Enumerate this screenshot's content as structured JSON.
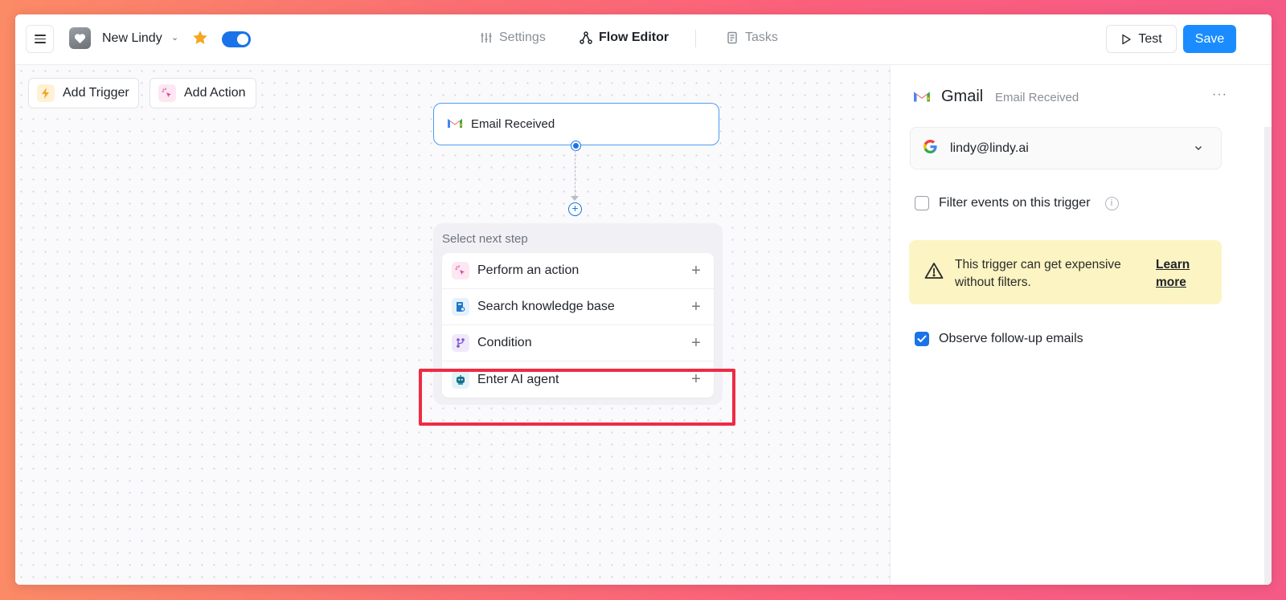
{
  "header": {
    "app_title": "New Lindy",
    "nav": {
      "settings": "Settings",
      "flow_editor": "Flow Editor",
      "tasks": "Tasks"
    },
    "test_label": "Test",
    "save_label": "Save",
    "toggle_on": true
  },
  "canvas": {
    "add_trigger": "Add Trigger",
    "add_action": "Add Action",
    "trigger_node": "Email Received",
    "next_step": {
      "title": "Select next step",
      "items": [
        {
          "label": "Perform an action",
          "icon": "sparkle-cursor-icon"
        },
        {
          "label": "Search knowledge base",
          "icon": "knowledge-base-icon"
        },
        {
          "label": "Condition",
          "icon": "branch-icon"
        },
        {
          "label": "Enter AI agent",
          "icon": "robot-icon"
        }
      ]
    }
  },
  "panel": {
    "title": "Gmail",
    "subtitle": "Email Received",
    "more": "···",
    "account": "lindy@lindy.ai",
    "filter_label": "Filter events on this trigger",
    "filter_checked": false,
    "warning_text": "This trigger can get expensive without filters.",
    "warning_link": "Learn more",
    "observe_label": "Observe follow-up emails",
    "observe_checked": true
  },
  "colors": {
    "primary": "#1a8cff",
    "highlight": "#ef2b44",
    "warning_bg": "#fcf4c2",
    "star": "#f5a623"
  }
}
